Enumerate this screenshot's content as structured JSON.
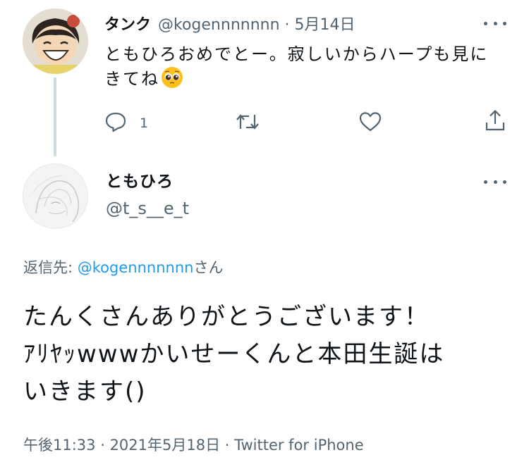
{
  "parent_tweet": {
    "display_name": "タンク",
    "handle": "@kogennnnnnn",
    "date": "5月14日",
    "text": "ともひろおめでとー。寂しいからハープも見にきてね",
    "reply_count": "1"
  },
  "main_tweet": {
    "display_name": "ともひろ",
    "handle": "@t_s__e_t",
    "reply_label": "返信先: ",
    "reply_mention": "@kogennnnnnn",
    "reply_suffix": "さん",
    "text_line1": "たんくさんありがとうございます！",
    "text_line2": "ｱﾘﾔｯwwwかいせーくんと本田生誕は",
    "text_line3": "いきます()",
    "time": "午後11:33",
    "date": "2021年5月18日",
    "source": "Twitter for iPhone"
  },
  "colors": {
    "text": "#0f1419",
    "secondary": "#536471",
    "link": "#1d9bf0",
    "thread_line": "#cfd9de"
  },
  "icons": [
    "more-icon",
    "reply-icon",
    "retweet-icon",
    "like-icon",
    "share-icon",
    "pleading-face-emoji"
  ]
}
